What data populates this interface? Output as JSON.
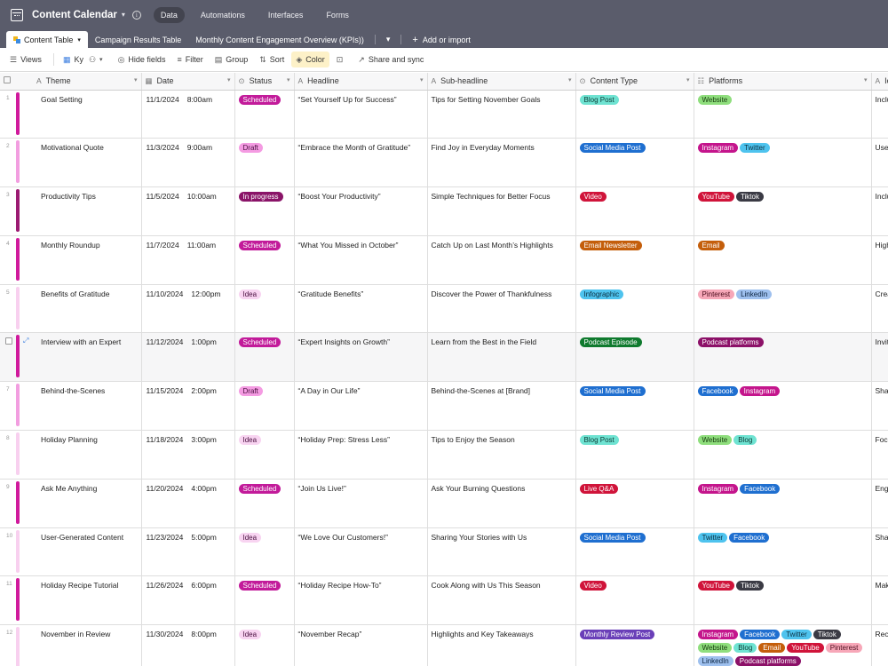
{
  "app": {
    "title": "Content Calendar",
    "top_tabs": [
      "Data",
      "Automations",
      "Interfaces",
      "Forms"
    ]
  },
  "tables": {
    "tabs": [
      "Content Table",
      "Campaign Results Table",
      "Monthly Content Engagement Overview (KPIs))"
    ],
    "add_label": "Add or import"
  },
  "toolbar": {
    "views": "Views",
    "view_name": "Ky",
    "hide_fields": "Hide fields",
    "filter": "Filter",
    "group": "Group",
    "sort": "Sort",
    "color": "Color",
    "share": "Share and sync"
  },
  "columns": [
    "Theme",
    "Date",
    "Status",
    "Headline",
    "Sub-headline",
    "Content Type",
    "Platforms",
    "Ic"
  ],
  "status_styles": {
    "Scheduled": {
      "bg": "#c21b9a",
      "fg": "#ffffff",
      "bar": "#d01a9c"
    },
    "Draft": {
      "bg": "#f49be2",
      "fg": "#4a1040",
      "bar": "#f29ee0"
    },
    "In progress": {
      "bg": "#8a1468",
      "fg": "#ffffff",
      "bar": "#9b1b72"
    },
    "Idea": {
      "bg": "#f8d4f1",
      "fg": "#4a1040",
      "bar": "#f8d0ef"
    }
  },
  "tag_styles": {
    "Blog Post": {
      "bg": "#6fe3d2",
      "fg": "#0c3a34"
    },
    "Social Media Post": {
      "bg": "#1f6fd0",
      "fg": "#ffffff"
    },
    "Video": {
      "bg": "#d0143a",
      "fg": "#ffffff"
    },
    "Email Newsletter": {
      "bg": "#c45e0b",
      "fg": "#ffffff"
    },
    "Infographic": {
      "bg": "#4ec3ee",
      "fg": "#0c2f40"
    },
    "Podcast Episode": {
      "bg": "#0f7a2e",
      "fg": "#ffffff"
    },
    "Live Q&A": {
      "bg": "#d0143a",
      "fg": "#ffffff"
    },
    "Monthly Review Post": {
      "bg": "#6a3fb8",
      "fg": "#ffffff"
    },
    "Website": {
      "bg": "#8fde7d",
      "fg": "#143a0c"
    },
    "Instagram": {
      "bg": "#c4158c",
      "fg": "#ffffff"
    },
    "Twitter": {
      "bg": "#4ec3ee",
      "fg": "#0c2f40"
    },
    "YouTube": {
      "bg": "#d0143a",
      "fg": "#ffffff"
    },
    "Tiktok": {
      "bg": "#3a3a44",
      "fg": "#ffffff"
    },
    "Email": {
      "bg": "#c45e0b",
      "fg": "#ffffff"
    },
    "Pinterest": {
      "bg": "#f7a7b8",
      "fg": "#4a0c1c"
    },
    "LinkedIn": {
      "bg": "#9ec0ee",
      "fg": "#0c2440"
    },
    "Podcast platforms": {
      "bg": "#8c1168",
      "fg": "#ffffff"
    },
    "Facebook": {
      "bg": "#1f6fd0",
      "fg": "#ffffff"
    },
    "Blog": {
      "bg": "#6fe3d2",
      "fg": "#0c3a34"
    }
  },
  "rows": [
    {
      "num": "1",
      "theme": "Goal Setting",
      "date": "11/1/2024",
      "time": "8:00am",
      "status": "Scheduled",
      "headline": "“Set Yourself Up for Success”",
      "sub": "Tips for Setting November Goals",
      "type": "Blog Post",
      "platforms": [
        "Website"
      ],
      "ic": "Inclu"
    },
    {
      "num": "2",
      "theme": "Motivational Quote",
      "date": "11/3/2024",
      "time": "9:00am",
      "status": "Draft",
      "headline": "“Embrace the Month of Gratitude”",
      "sub": "Find Joy in Everyday Moments",
      "type": "Social Media Post",
      "platforms": [
        "Instagram",
        "Twitter"
      ],
      "ic": "Use a"
    },
    {
      "num": "3",
      "theme": "Productivity Tips",
      "date": "11/5/2024",
      "time": "10:00am",
      "status": "In progress",
      "headline": "“Boost Your Productivity”",
      "sub": "Simple Techniques for Better Focus",
      "type": "Video",
      "platforms": [
        "YouTube",
        "Tiktok"
      ],
      "ic": "Inclu"
    },
    {
      "num": "4",
      "theme": "Monthly Roundup",
      "date": "11/7/2024",
      "time": "11:00am",
      "status": "Scheduled",
      "headline": "“What You Missed in October”",
      "sub": "Catch Up on Last Month’s Highlights",
      "type": "Email Newsletter",
      "platforms": [
        "Email"
      ],
      "ic": "High"
    },
    {
      "num": "5",
      "theme": "Benefits of Gratitude",
      "date": "11/10/2024",
      "time": "12:00pm",
      "status": "Idea",
      "headline": "“Gratitude Benefits”",
      "sub": "Discover the Power of Thankfulness",
      "type": "Infographic",
      "platforms": [
        "Pinterest",
        "LinkedIn"
      ],
      "ic": "Creat"
    },
    {
      "num": "",
      "theme": "Interview with an Expert",
      "date": "11/12/2024",
      "time": "1:00pm",
      "status": "Scheduled",
      "headline": "“Expert Insights on Growth”",
      "sub": "Learn from the Best in the Field",
      "type": "Podcast Episode",
      "platforms": [
        "Podcast platforms"
      ],
      "ic": "Invite",
      "hover": true
    },
    {
      "num": "7",
      "theme": "Behind-the-Scenes",
      "date": "11/15/2024",
      "time": "2:00pm",
      "status": "Draft",
      "headline": "“A Day in Our Life”",
      "sub": "Behind-the-Scenes at [Brand]",
      "type": "Social Media Post",
      "platforms": [
        "Facebook",
        "Instagram"
      ],
      "ic": "Share"
    },
    {
      "num": "8",
      "theme": "Holiday Planning",
      "date": "11/18/2024",
      "time": "3:00pm",
      "status": "Idea",
      "headline": "“Holiday Prep: Stress Less”",
      "sub": "Tips to Enjoy the Season",
      "type": "Blog Post",
      "platforms": [
        "Website",
        "Blog"
      ],
      "ic": "Focu"
    },
    {
      "num": "9",
      "theme": "Ask Me Anything",
      "date": "11/20/2024",
      "time": "4:00pm",
      "status": "Scheduled",
      "headline": "“Join Us Live!”",
      "sub": "Ask Your Burning Questions",
      "type": "Live Q&A",
      "platforms": [
        "Instagram",
        "Facebook"
      ],
      "ic": "Enga"
    },
    {
      "num": "10",
      "theme": "User-Generated Content",
      "date": "11/23/2024",
      "time": "5:00pm",
      "status": "Idea",
      "headline": "“We Love Our Customers!”",
      "sub": "Sharing Your Stories with Us",
      "type": "Social Media Post",
      "platforms": [
        "Twitter",
        "Facebook"
      ],
      "ic": "Share"
    },
    {
      "num": "11",
      "theme": "Holiday Recipe Tutorial",
      "date": "11/26/2024",
      "time": "6:00pm",
      "status": "Scheduled",
      "headline": "“Holiday Recipe How-To”",
      "sub": "Cook Along with Us This Season",
      "type": "Video",
      "platforms": [
        "YouTube",
        "Tiktok"
      ],
      "ic": "Mak"
    },
    {
      "num": "12",
      "theme": "November in Review",
      "date": "11/30/2024",
      "time": "8:00pm",
      "status": "Idea",
      "headline": "“November Recap”",
      "sub": "Highlights and Key Takeaways",
      "type": "Monthly Review Post",
      "platforms": [
        "Instagram",
        "Facebook",
        "Twitter",
        "Tiktok",
        "Website",
        "Blog",
        "Email",
        "YouTube",
        "Pinterest",
        "LinkedIn",
        "Podcast platforms"
      ],
      "ic": "Reca"
    }
  ]
}
